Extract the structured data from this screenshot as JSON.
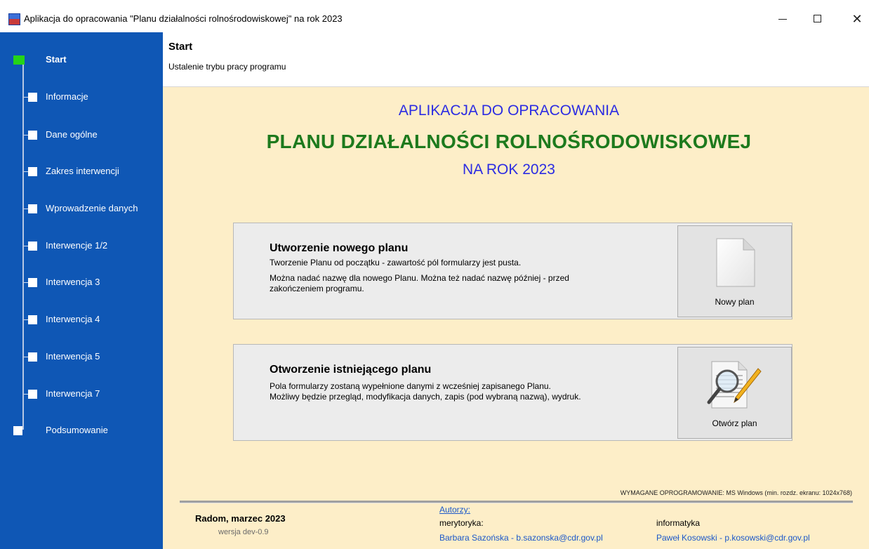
{
  "window": {
    "title": "Aplikacja do opracowania \"Planu działalności rolnośrodowiskowej\" na rok 2023",
    "minimize_glyph": "—",
    "maximize_glyph": "☐",
    "close_glyph": "✕"
  },
  "sidebar": {
    "items": [
      {
        "label": "Start",
        "active": true
      },
      {
        "label": "Informacje"
      },
      {
        "label": "Dane ogólne"
      },
      {
        "label": "Zakres interwencji"
      },
      {
        "label": "Wprowadzenie danych"
      },
      {
        "label": "Interwencje 1/2"
      },
      {
        "label": "Interwencja 3"
      },
      {
        "label": "Interwencja 4"
      },
      {
        "label": "Interwencja 5"
      },
      {
        "label": "Interwencja 7"
      },
      {
        "label": "Podsumowanie"
      }
    ],
    "colors": {
      "background": "#0f57b5",
      "active_node": "#25d418",
      "node": "#ffffff"
    }
  },
  "header": {
    "title": "Start",
    "subtitle": "Ustalenie trybu pracy programu"
  },
  "main": {
    "heading_line1": "APLIKACJA DO OPRACOWANIA",
    "heading_line2": "PLANU DZIAŁALNOŚCI ROLNOŚRODOWISKOWEJ",
    "heading_line3": "NA ROK 2023",
    "new_plan": {
      "title": "Utworzenie nowego planu",
      "line1": "Tworzenie Planu od początku - zawartość pól formularzy jest pusta.",
      "line2": "Można nadać nazwę dla nowego Planu. Można też nadać nazwę później - przed",
      "line3": "zakończeniem programu.",
      "button_label": "Nowy plan",
      "icon": "document-icon"
    },
    "open_plan": {
      "title": "Otworzenie istniejącego planu",
      "line1": "Pola formularzy zostaną wypełnione danymi z wcześniej zapisanego Planu.",
      "line2": "Możliwy będzie przegląd, modyfikacja danych, zapis (pod wybraną nazwą), wydruk.",
      "button_label": "Otwórz plan",
      "icon": "magnifier-document-icon"
    },
    "colors": {
      "background": "#fdeec8",
      "heading_blue": "#2c2ce2",
      "heading_green": "#1d7a1d"
    }
  },
  "footer": {
    "requirements": "WYMAGANE OPROGRAMOWANIE: MS Windows (min. rozdz. ekranu: 1024x768)",
    "city_date": "Radom, marzec 2023",
    "version": "wersja dev-0.9",
    "authors_label": "Autorzy:",
    "merytoryka_label": "merytoryka:",
    "informatyka_label": "informatyka",
    "author1": "Barbara Sazońska - b.sazonska@cdr.gov.pl",
    "author2": "Paweł Kosowski - p.kosowski@cdr.gov.pl"
  }
}
